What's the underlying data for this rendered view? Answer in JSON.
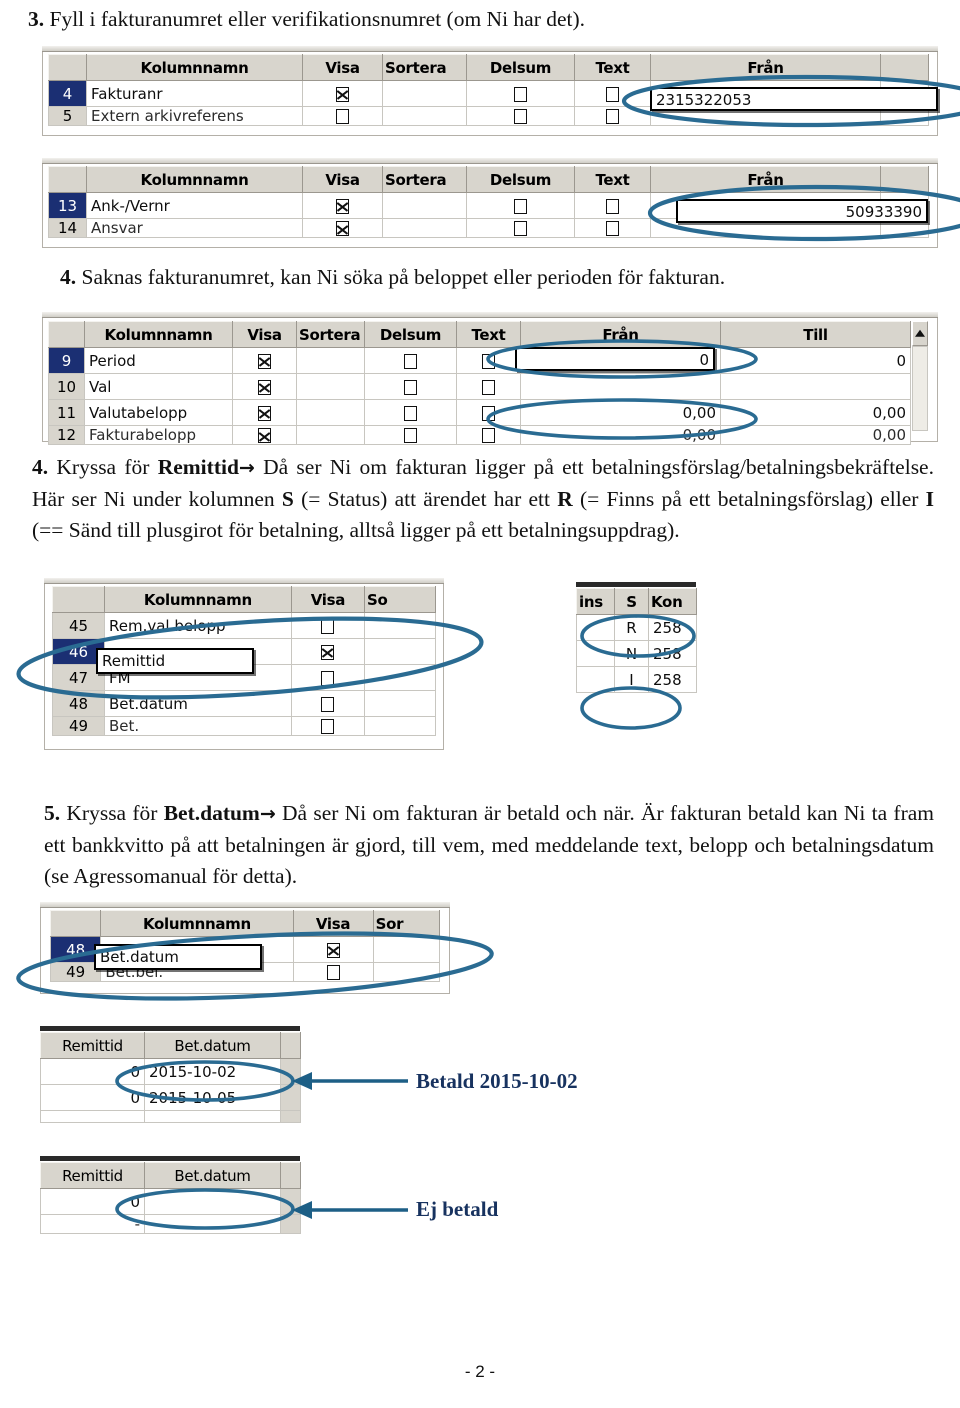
{
  "document": {
    "footer": "- 2 -"
  },
  "steps": {
    "step3": {
      "number": "3.",
      "text": "Fyll i fakturanumret eller verifikationsnumret (om Ni har det)."
    },
    "step4a": {
      "number": "4.",
      "text": "Saknas fakturanumret, kan Ni söka på beloppet eller perioden för fakturan."
    },
    "step4b": {
      "number": "4.",
      "part1": "Kryssa för ",
      "bold1": "Remittid",
      "arrow": "→",
      "part2": " Då ser Ni om fakturan ligger på ett betalningsförslag/betalningsbekräftelse. Här ser Ni under kolumnen ",
      "bold2": "S",
      "part3": " (= Status) att ärendet har ett ",
      "bold3": "R",
      "part4": " (= Finns på ett betalningsförslag) eller ",
      "bold4": "I",
      "part5": " (== Sänd till plusgirot för betalning, alltså ligger på ett betalningsuppdrag)."
    },
    "step5": {
      "number": "5.",
      "part1": "Kryssa för ",
      "bold1": "Bet.datum",
      "arrow": "→",
      "part2": " Då ser Ni om fakturan är betald och när. Är fakturan betald kan Ni ta fram ett bankkvitto på att betalningen är gjord, till vem, med meddelande text, belopp och betalningsdatum (se Agressomanual för detta)."
    }
  },
  "screenshots": {
    "fakturanr": {
      "headers": [
        "",
        "Kolumnnamn",
        "Visa",
        "Sortera",
        "Delsum",
        "Text",
        "Från",
        ""
      ],
      "header_sorted_truncated": "Sortera",
      "rows": [
        {
          "num": "4",
          "selected": true,
          "name": "Fakturanr",
          "visa": "x",
          "sortera": "",
          "delsum": "empty",
          "text": "empty"
        },
        {
          "num": "5",
          "selected": false,
          "name": "Extern arkivreferens",
          "visa": "empty",
          "sortera": "",
          "delsum": "empty",
          "text": "empty"
        }
      ],
      "edit_value": "2315322053",
      "selected_column": "Från"
    },
    "ankvernr": {
      "headers": [
        "",
        "Kolumnnamn",
        "Visa",
        "Sortera",
        "Delsum",
        "Text",
        "Från",
        ""
      ],
      "rows": [
        {
          "num": "13",
          "selected": true,
          "name": "Ank-/Vernr",
          "visa": "x",
          "sortera": "",
          "delsum": "empty",
          "text": "empty"
        },
        {
          "num": "14",
          "selected": false,
          "name": "Ansvar",
          "visa": "x",
          "sortera": "",
          "delsum": "empty",
          "text": "empty"
        }
      ],
      "edit_value": "50933390",
      "selected_column": "Från"
    },
    "period": {
      "headers": [
        "",
        "Kolumnnamn",
        "Visa",
        "Sortera",
        "Delsum",
        "Text",
        "Från",
        "Till"
      ],
      "rows": [
        {
          "num": "9",
          "selected": true,
          "name": "Period",
          "visa": "x",
          "delsum": "empty",
          "text": "empty",
          "fran": "0",
          "till": "0"
        },
        {
          "num": "10",
          "selected": false,
          "name": "Val",
          "visa": "x",
          "delsum": "empty",
          "text": "empty",
          "fran": "",
          "till": ""
        },
        {
          "num": "11",
          "selected": false,
          "name": "Valutabelopp",
          "visa": "x",
          "delsum": "empty",
          "text": "empty",
          "fran": "0,00",
          "till": "0,00"
        },
        {
          "num": "12",
          "selected": false,
          "name": "Fakturabelopp",
          "visa": "x",
          "delsum": "empty",
          "text": "empty",
          "fran": "0,00",
          "till": "0,00"
        }
      ],
      "edit_value": "0",
      "selected_column": "Från"
    },
    "remittid": {
      "headers": [
        "",
        "Kolumnnamn",
        "Visa",
        "Sortera"
      ],
      "header_visa": "Visa",
      "header_sortera_truncated": "So",
      "rows": [
        {
          "num": "45",
          "selected": false,
          "name": "Rem.val.belopp",
          "visa": "empty"
        },
        {
          "num": "46",
          "selected": true,
          "name": "Remittid",
          "visa": "x"
        },
        {
          "num": "47",
          "selected": false,
          "name": "FM",
          "visa": "empty"
        },
        {
          "num": "48",
          "selected": false,
          "name": "Bet.datum",
          "visa": "empty"
        },
        {
          "num": "49",
          "selected": false,
          "name": "Bet.",
          "visa": "empty"
        }
      ],
      "edit_value": "Remittid"
    },
    "status": {
      "headers": [
        "ins",
        "S",
        "Kon"
      ],
      "rows": [
        {
          "ins": "",
          "s": "R",
          "kon": "258"
        },
        {
          "ins": "",
          "s": "N",
          "kon": "258"
        },
        {
          "ins": "",
          "s": "I",
          "kon": "258"
        }
      ]
    },
    "betdatum": {
      "headers": [
        "",
        "Kolumnnamn",
        "Visa",
        "Sor"
      ],
      "rows": [
        {
          "num": "48",
          "selected": true,
          "name": "Bet.datum",
          "visa": "x"
        },
        {
          "num": "49",
          "selected": false,
          "name": "Bet.bel.",
          "visa": "empty"
        }
      ],
      "edit_value": "Bet.datum"
    },
    "betald_table": {
      "headers": [
        "Remittid",
        "Bet.datum"
      ],
      "rows": [
        {
          "remittid": "0",
          "betdatum": "2015-10-02"
        },
        {
          "remittid": "0",
          "betdatum": "2015-10-05"
        }
      ]
    },
    "ejbetald_table": {
      "headers": [
        "Remittid",
        "Bet.datum"
      ],
      "rows": [
        {
          "remittid": "0",
          "betdatum": ""
        },
        {
          "remittid": "-",
          "betdatum": ""
        }
      ]
    }
  },
  "annotations": {
    "betald": "Betald 2015-10-02",
    "ej_betald": "Ej betald"
  },
  "colors": {
    "accent_ellipse": "#2a6b92",
    "callout_text": "#17325f",
    "selection_navy": "#1b2f73",
    "header_gray": "#d8d5cd"
  }
}
